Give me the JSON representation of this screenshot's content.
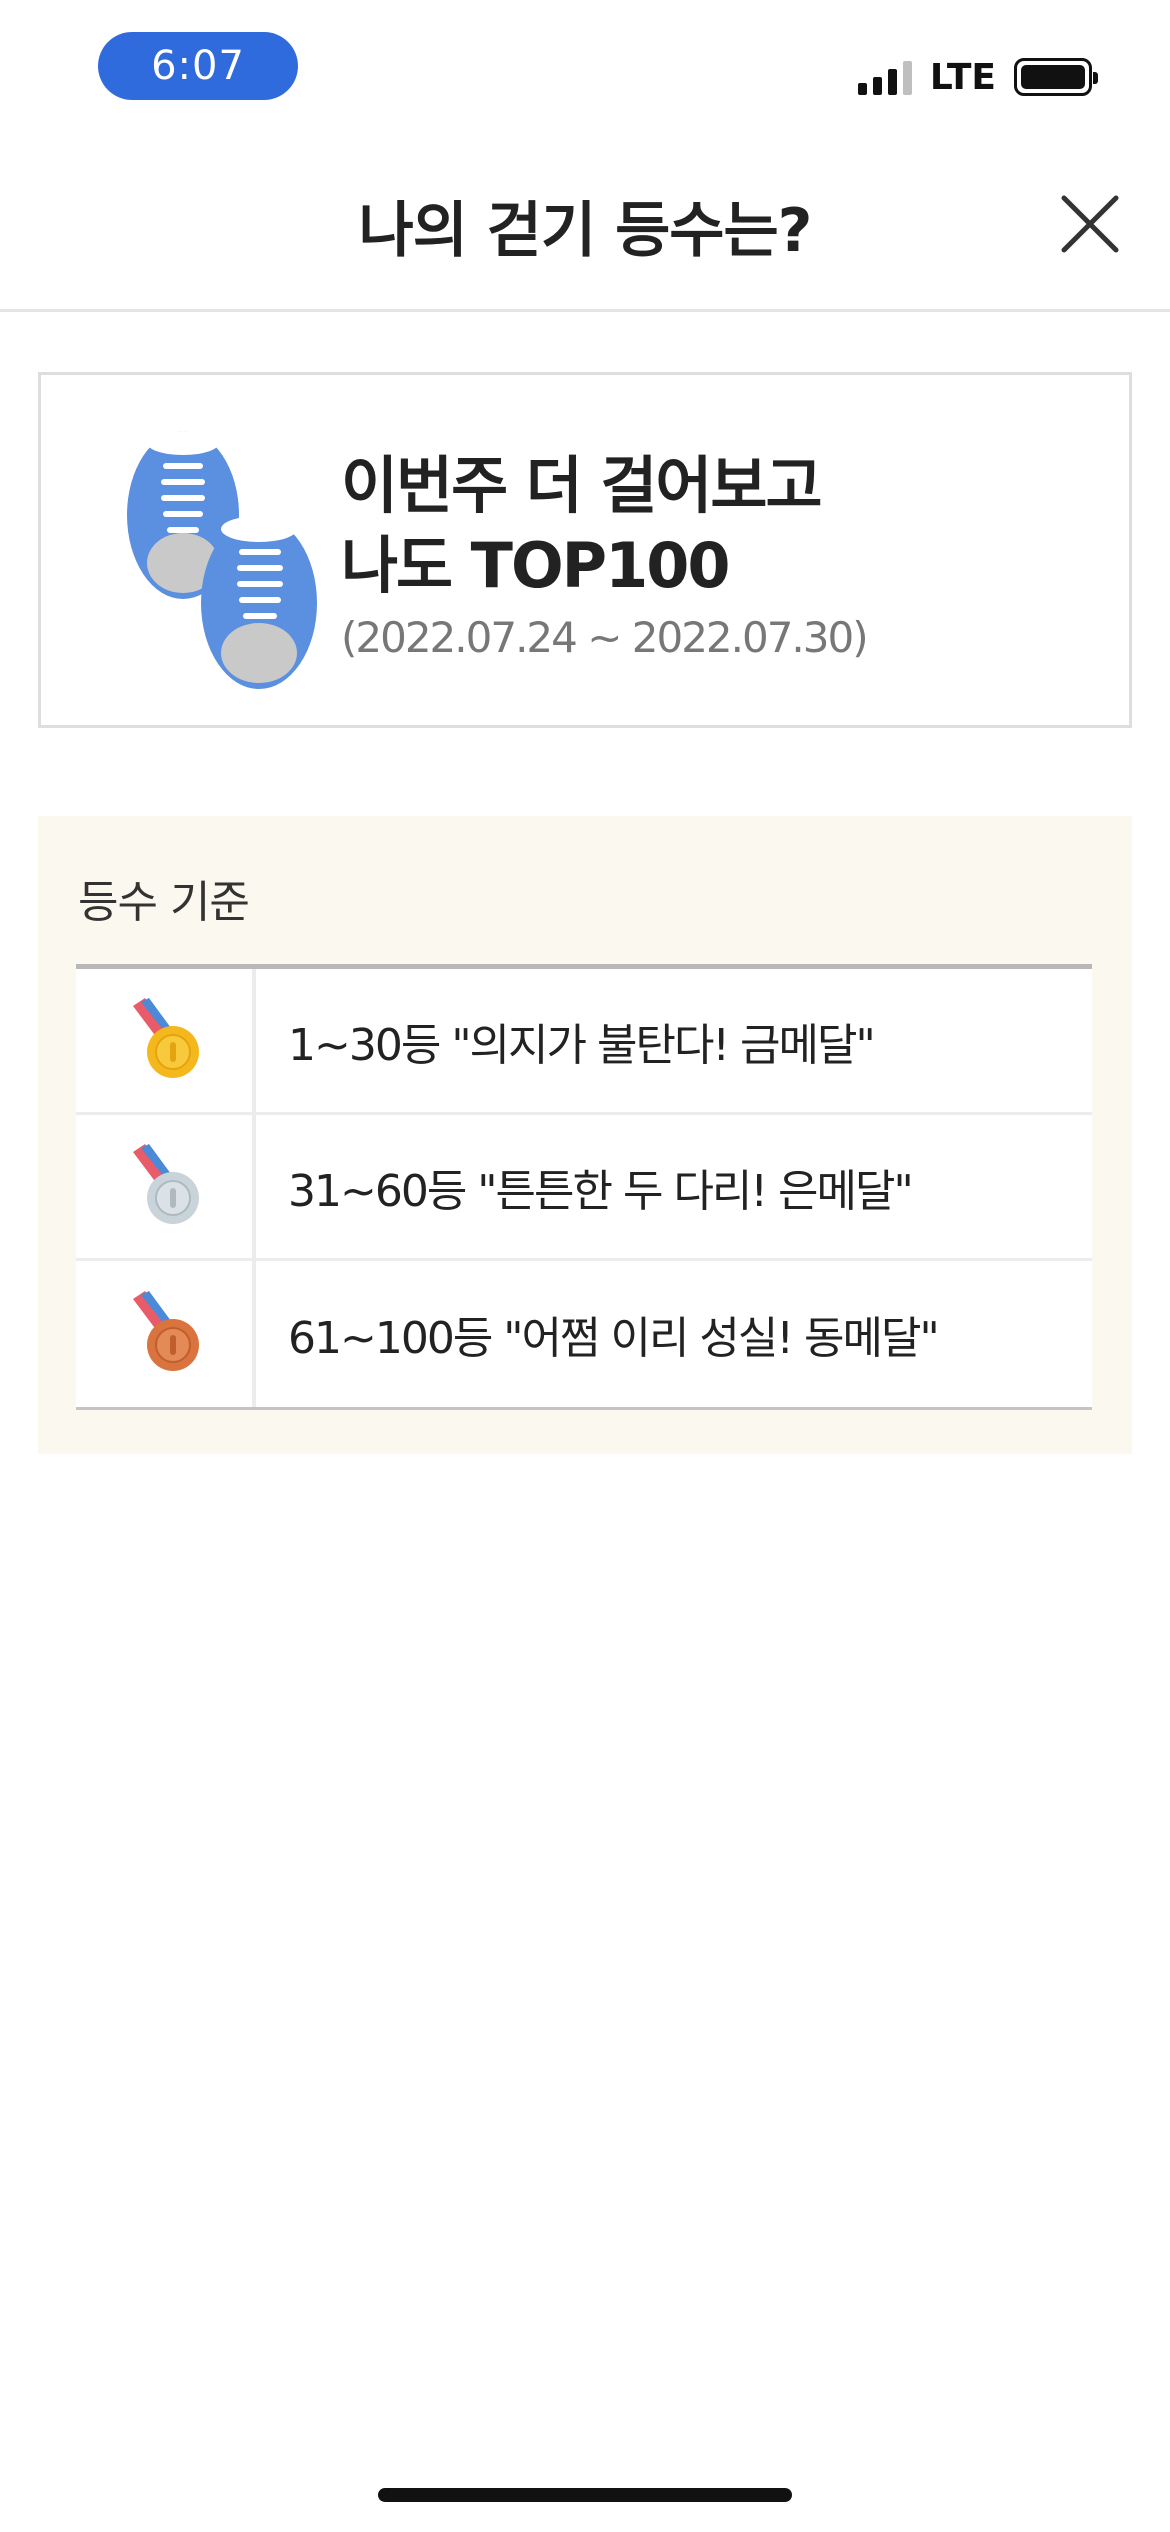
{
  "status_bar": {
    "time": "6:07",
    "network": "LTE"
  },
  "header": {
    "title": "나의 걷기 등수는?",
    "close_icon": "close-icon"
  },
  "promo": {
    "icon": "sneakers-icon",
    "line1": "이번주 더 걸어보고",
    "line2": "나도 TOP100",
    "date_range": "(2022.07.24 ~ 2022.07.30)"
  },
  "criteria": {
    "title": "등수 기준",
    "rows": [
      {
        "medal": "gold-medal-icon",
        "label": "1~30등 \"의지가 불탄다! 금메달\""
      },
      {
        "medal": "silver-medal-icon",
        "label": "31~60등 \"튼튼한 두 다리! 은메달\""
      },
      {
        "medal": "bronze-medal-icon",
        "label": "61~100등 \"어쩜 이리 성실! 동메달\""
      }
    ]
  },
  "colors": {
    "time_pill": "#2f6bdc",
    "criteria_bg": "#fbf8ef",
    "gold": "#f5b81c",
    "silver": "#c9d3da",
    "bronze": "#d9743f",
    "shoe": "#5b8fe0"
  }
}
